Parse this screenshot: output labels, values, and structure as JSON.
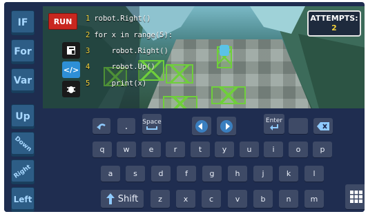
{
  "sidebar": {
    "commands": [
      {
        "label": "IF"
      },
      {
        "label": "For"
      },
      {
        "label": "Var"
      },
      {
        "label": "Up"
      },
      {
        "label": "Down"
      },
      {
        "label": "Right"
      },
      {
        "label": "Left"
      }
    ]
  },
  "toolbar": {
    "run_label": "RUN",
    "modes": [
      {
        "icon": "book-icon"
      },
      {
        "icon": "code-icon",
        "active": true
      },
      {
        "icon": "bug-icon"
      }
    ]
  },
  "code": {
    "lines": [
      {
        "num": "1",
        "text": "robot.Right()"
      },
      {
        "num": "2",
        "text": "for x in range(5):"
      },
      {
        "num": "3",
        "text": "    robot.Right()"
      },
      {
        "num": "4",
        "text": "    robot.Up()"
      },
      {
        "num": "5",
        "text": "    print(x)"
      }
    ]
  },
  "attempts": {
    "label": "ATTEMPTS:",
    "value": "2"
  },
  "keyboard": {
    "row0": {
      "undo_icon": "undo-icon",
      "dot": ".",
      "space": "Space",
      "left_icon": "arrow-left-circle-icon",
      "right_icon": "arrow-right-circle-icon",
      "enter": "Enter",
      "backspace_icon": "backspace-icon"
    },
    "row1": [
      "q",
      "w",
      "e",
      "r",
      "t",
      "y",
      "u",
      "i",
      "o",
      "p"
    ],
    "row2": [
      "a",
      "s",
      "d",
      "f",
      "g",
      "h",
      "j",
      "k",
      "l"
    ],
    "row3_shift": "Shift",
    "row3": [
      "z",
      "x",
      "c",
      "v",
      "b",
      "n",
      "m"
    ],
    "grid_icon": "grid-icon"
  },
  "colors": {
    "accent": "#3a7fc0",
    "run": "#c9271f",
    "code_line_number": "#f4d23c",
    "crate": "#6fcf3b"
  }
}
